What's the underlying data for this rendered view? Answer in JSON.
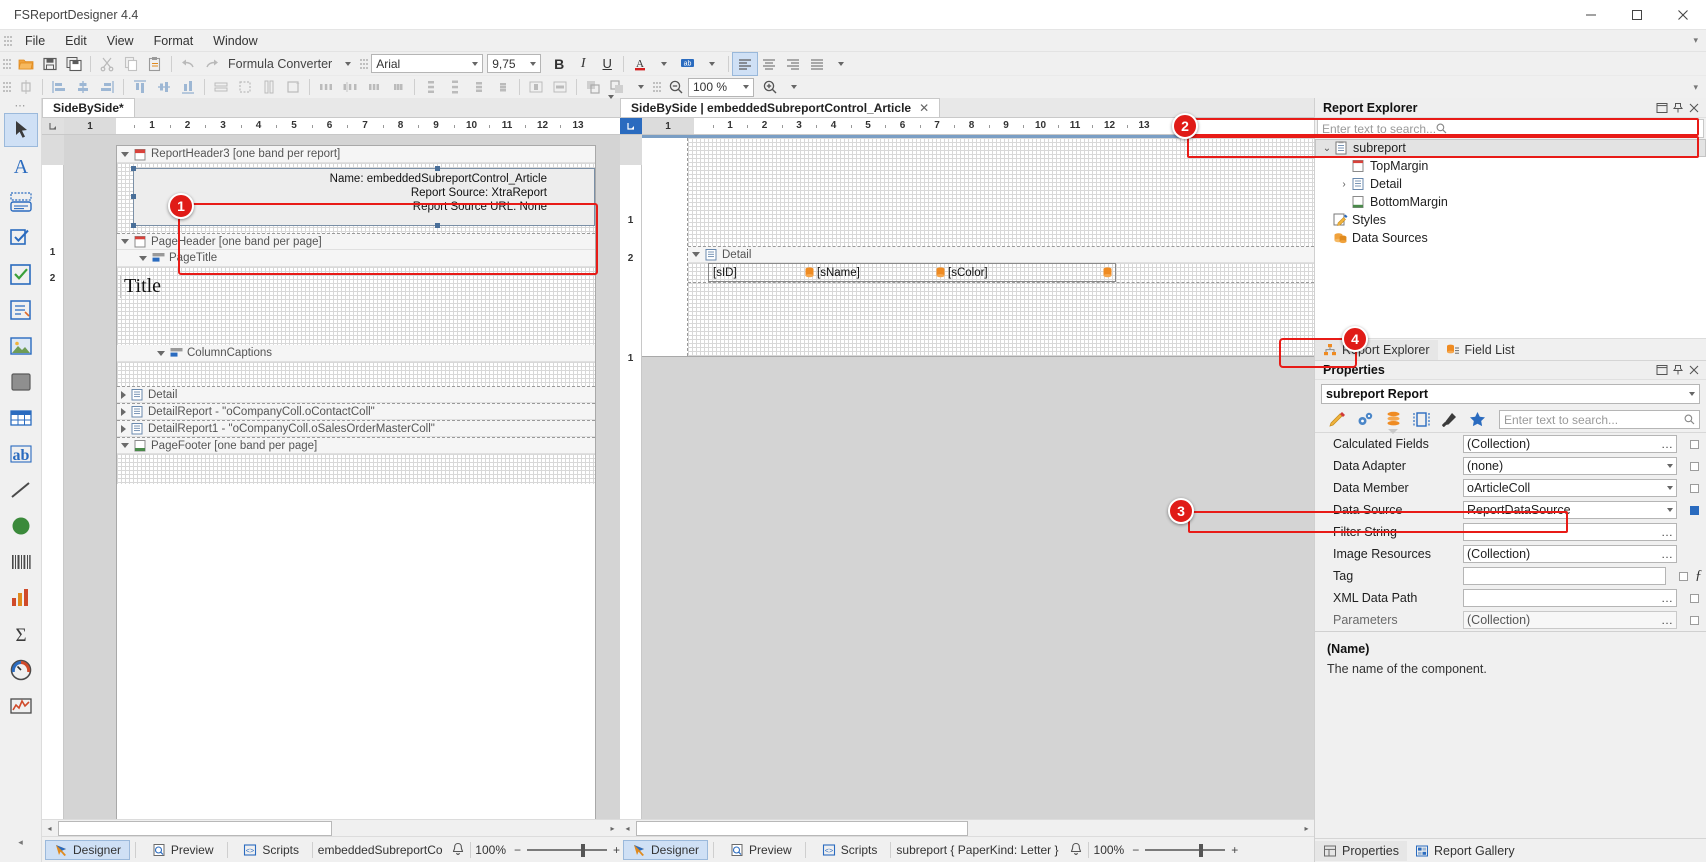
{
  "window": {
    "title": "FSReportDesigner 4.4",
    "minimize": "─",
    "maximize": "☐",
    "close": "✕"
  },
  "menu": {
    "items": [
      "File",
      "Edit",
      "View",
      "Format",
      "Window"
    ]
  },
  "toolbar": {
    "formula_converter": "Formula Converter",
    "font_family": "Arial",
    "font_size": "9,75",
    "bold": "B",
    "italic": "I",
    "underline": "U",
    "font_color": "A",
    "highlight": "ab",
    "zoom_level": "100 %",
    "icons": [
      "open-icon",
      "save-icon",
      "save-all-icon",
      "cut-icon",
      "copy-icon",
      "paste-icon",
      "undo-icon",
      "redo-icon",
      "align-left-icon",
      "align-center-icon",
      "align-right-icon",
      "justify-icon"
    ]
  },
  "toolstrip": {
    "items": [
      {
        "name": "pointer-tool",
        "glyph": "pointer"
      },
      {
        "name": "label-tool",
        "glyph": "A"
      },
      {
        "name": "rich-text-tool",
        "glyph": "richtext"
      },
      {
        "name": "check-box-tool",
        "glyph": "checkbox-blue"
      },
      {
        "name": "check-box-tool2",
        "glyph": "checkbox-check"
      },
      {
        "name": "panel-tool",
        "glyph": "panel"
      },
      {
        "name": "picture-box-tool",
        "glyph": "picture"
      },
      {
        "name": "shape-tool",
        "glyph": "square"
      },
      {
        "name": "table-tool",
        "glyph": "table"
      },
      {
        "name": "character-comb-tool",
        "glyph": "ab"
      },
      {
        "name": "line-tool",
        "glyph": "line"
      },
      {
        "name": "ellipse-tool",
        "glyph": "circle"
      },
      {
        "name": "barcode-tool",
        "glyph": "barcode"
      },
      {
        "name": "chart-tool",
        "glyph": "chart"
      },
      {
        "name": "pivot-grid-tool",
        "glyph": "sigma"
      },
      {
        "name": "gauge-tool",
        "glyph": "gauge"
      },
      {
        "name": "sparkline-tool",
        "glyph": "sparkline"
      }
    ]
  },
  "left_designer": {
    "tab_label": "SideBySide*",
    "ruler_page": "1",
    "ruler_ticks": [
      "1",
      "2",
      "3",
      "4",
      "5",
      "6",
      "7",
      "8",
      "9",
      "10",
      "11",
      "12",
      "13"
    ],
    "vruler_ticks": [
      "1",
      "2"
    ],
    "bands": [
      {
        "name": "ReportHeader3 [one band per report]",
        "icon": "report-header-icon",
        "expanded": true
      },
      {
        "name": "PageHeader [one band per page]",
        "icon": "page-header-icon",
        "expanded": true
      },
      {
        "name": "PageTitle",
        "icon": "page-title-icon",
        "expanded": true,
        "indent": 1
      },
      {
        "name": "ColumnCaptions",
        "icon": "column-captions-icon",
        "expanded": true,
        "indent": 1
      },
      {
        "name": "Detail",
        "icon": "detail-icon",
        "expanded": false
      },
      {
        "name": "DetailReport - \"oCompanyColl.oContactColl\"",
        "icon": "detail-report-icon",
        "expanded": false
      },
      {
        "name": "DetailReport1 - \"oCompanyColl.oSalesOrderMasterColl\"",
        "icon": "detail-report-icon",
        "expanded": false
      },
      {
        "name": "PageFooter [one band per page]",
        "icon": "page-footer-icon",
        "expanded": true
      }
    ],
    "subreport_lines": [
      "Name: embeddedSubreportControl_Article",
      "Report Source: XtraReport",
      "Report Source URL: None"
    ],
    "title_text": "Title",
    "status": {
      "designer": "Designer",
      "preview": "Preview",
      "scripts": "Scripts",
      "doc": "embeddedSubreportControl_/",
      "zoom": "100%",
      "minus": "−",
      "plus": "+"
    }
  },
  "right_designer": {
    "tab_label": "SideBySide | embeddedSubreportControl_Article",
    "close": "✕",
    "ruler_page": "1",
    "ruler_ticks": [
      "1",
      "2",
      "3",
      "4",
      "5",
      "6",
      "7",
      "8",
      "9",
      "10",
      "11",
      "12",
      "13"
    ],
    "vruler_ticks": [
      "1",
      "2",
      "1"
    ],
    "detail_band": "Detail",
    "fields": [
      "[sID]",
      "[sName]",
      "[sColor]"
    ],
    "status": {
      "designer": "Designer",
      "preview": "Preview",
      "scripts": "Scripts",
      "doc": "subreport { PaperKind: Letter }",
      "zoom": "100%",
      "minus": "−",
      "plus": "+"
    }
  },
  "report_explorer": {
    "title": "Report Explorer",
    "search_placeholder": "Enter text to search...",
    "tree": [
      {
        "label": "subreport",
        "indent": 0,
        "chev": "⌄",
        "icon": "report-icon",
        "selected": true
      },
      {
        "label": "TopMargin",
        "indent": 1,
        "chev": "",
        "icon": "top-margin-icon",
        "selected": false
      },
      {
        "label": "Detail",
        "indent": 1,
        "chev": "›",
        "icon": "detail-band-icon",
        "selected": false
      },
      {
        "label": "BottomMargin",
        "indent": 1,
        "chev": "",
        "icon": "bottom-margin-icon",
        "selected": false
      },
      {
        "label": "Styles",
        "indent": 0,
        "chev": "",
        "icon": "styles-icon",
        "selected": false
      },
      {
        "label": "Data Sources",
        "indent": 0,
        "chev": "",
        "icon": "data-sources-icon",
        "selected": false
      }
    ],
    "tabs": [
      {
        "label": "Report Explorer",
        "icon": "report-explorer-icon",
        "selected": true
      },
      {
        "label": "Field List",
        "icon": "field-list-icon",
        "selected": false
      }
    ]
  },
  "properties": {
    "title": "Properties",
    "selected_object": "subreport   Report",
    "search_placeholder": "Enter text to search...",
    "category_icons": [
      "appearance-icon",
      "behavior-icon",
      "data-icon",
      "layout-icon",
      "misc-icon",
      "favorites-icon"
    ],
    "rows": [
      {
        "name": "Calculated Fields",
        "value": "(Collection)",
        "editor": "ellipsis",
        "square": "empty",
        "muted": false
      },
      {
        "name": "Data Adapter",
        "value": "(none)",
        "editor": "dropdown",
        "square": "empty",
        "muted": false
      },
      {
        "name": "Data Member",
        "value": "oArticleColl",
        "editor": "dropdown",
        "square": "empty",
        "muted": false
      },
      {
        "name": "Data Source",
        "value": "ReportDataSource",
        "editor": "dropdown",
        "square": "filled",
        "muted": false
      },
      {
        "name": "Filter String",
        "value": "",
        "editor": "ellipsis",
        "square": "none",
        "muted": false
      },
      {
        "name": "Image Resources",
        "value": "(Collection)",
        "editor": "ellipsis",
        "square": "none",
        "muted": false
      },
      {
        "name": "Tag",
        "value": "",
        "editor": "none",
        "square": "empty",
        "muted": false
      },
      {
        "name": "XML Data Path",
        "value": "",
        "editor": "ellipsis",
        "square": "empty",
        "muted": false
      },
      {
        "name": "Parameters",
        "value": "(Collection)",
        "editor": "ellipsis",
        "square": "empty",
        "muted": true
      }
    ],
    "fx_glyph": "ƒ",
    "desc_title": "(Name)",
    "desc_text": "The name of the component.",
    "tabs": [
      {
        "label": "Properties",
        "icon": "properties-icon",
        "selected": true
      },
      {
        "label": "Report Gallery",
        "icon": "report-gallery-icon",
        "selected": false
      }
    ]
  },
  "annotations": [
    {
      "n": "1"
    },
    {
      "n": "2"
    },
    {
      "n": "3"
    },
    {
      "n": "4"
    }
  ],
  "colors": {
    "accent_red": "#e01b17",
    "orange": "#ef8b22",
    "blue": "#2a6bbf",
    "chrome": "#f0f0f0"
  }
}
